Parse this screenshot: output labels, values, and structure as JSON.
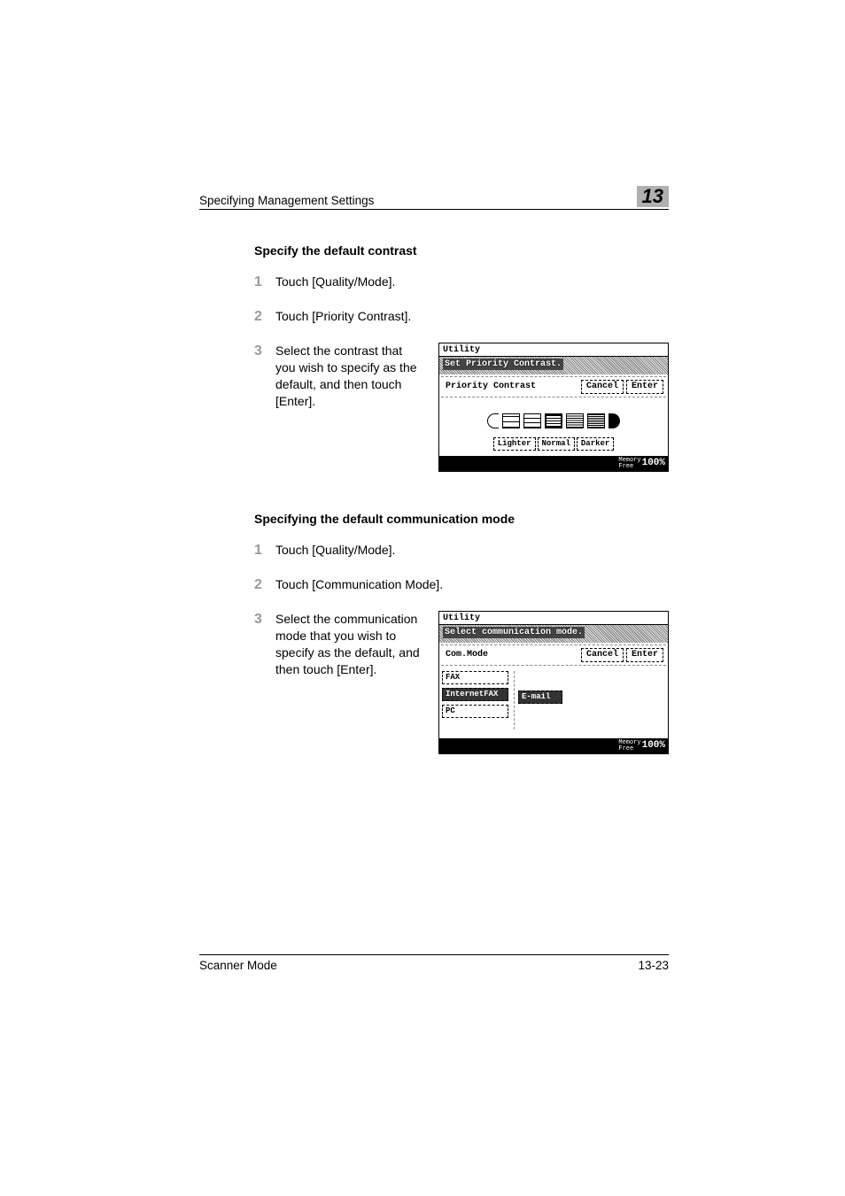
{
  "header": {
    "title": "Specifying Management Settings",
    "chapter_number": "13"
  },
  "section1": {
    "heading": "Specify the default contrast",
    "steps": [
      {
        "num": "1",
        "text": "Touch [Quality/Mode]."
      },
      {
        "num": "2",
        "text": "Touch [Priority Contrast]."
      },
      {
        "num": "3",
        "text": "Select the contrast that you wish to specify as the default, and then touch [Enter]."
      }
    ]
  },
  "lcd1": {
    "title": "Utility",
    "banner": "Set Priority Contrast.",
    "row_label": "Priority Contrast",
    "cancel": "Cancel",
    "enter": "Enter",
    "scale_labels": {
      "lighter": "Lighter",
      "normal": "Normal",
      "darker": "Darker"
    },
    "footer": {
      "memory_label": "Memory",
      "free_label": "Free",
      "percent": "100%"
    }
  },
  "section2": {
    "heading": "Specifying the default communication mode",
    "steps": [
      {
        "num": "1",
        "text": "Touch [Quality/Mode]."
      },
      {
        "num": "2",
        "text": "Touch [Communication Mode]."
      },
      {
        "num": "3",
        "text": "Select the communication mode that you wish to specify as the default, and then touch [Enter]."
      }
    ]
  },
  "lcd2": {
    "title": "Utility",
    "banner": "Select communication mode.",
    "row_label": "Com.Mode",
    "cancel": "Cancel",
    "enter": "Enter",
    "modes": {
      "fax": "FAX",
      "internet_fax": "InternetFAX",
      "email": "E-mail",
      "pc": "PC"
    },
    "footer": {
      "memory_label": "Memory",
      "free_label": "Free",
      "percent": "100%"
    }
  },
  "footer": {
    "left": "Scanner Mode",
    "right": "13-23"
  }
}
